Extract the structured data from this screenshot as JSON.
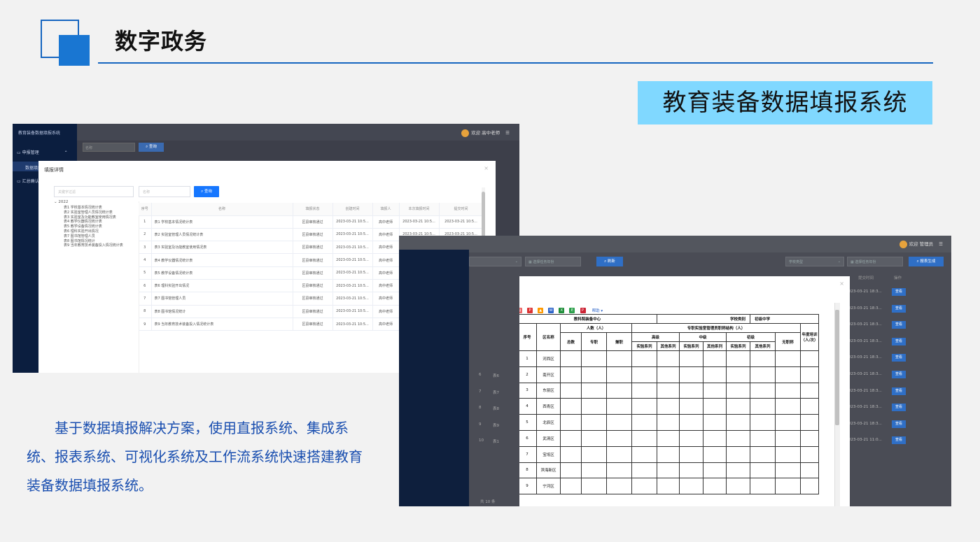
{
  "header": {
    "title": "数字政务",
    "system_banner": "教育装备数据填报系统",
    "description": "基于数据填报解决方案，使用直报系统、集成系统、报表系统、可视化系统及工作流系统快速搭建教育装备数据填报系统。"
  },
  "screenshot1": {
    "app_title": "教育装备数据填报系统",
    "menu": [
      "申报管理",
      "数据填报",
      "汇总确认"
    ],
    "user_label": "欢迎 高中老师",
    "bg_search_placeholder": "名称",
    "bg_search_button": "查询",
    "dialog": {
      "title": "填报详情",
      "keyword_placeholder": "关键字过滤",
      "name_placeholder": "名称",
      "query_button": "查询",
      "tree_year": "2022",
      "tree_items": [
        "表1 学校基本情况统计表",
        "表2 实验室管理人员情况统计表",
        "表3 实验室及功能教室使用情况表",
        "表4 教学仪器情况统计表",
        "表5 教学设备情况统计表",
        "表6 理科实验开出情况",
        "表7 图书馆管理人员",
        "表8 图书馆情况统计",
        "表9 当年教育技术装备投入情况统计表"
      ],
      "columns": [
        "序号",
        "名称",
        "填报状态",
        "创建时间",
        "填报人",
        "本次填报时间",
        "提交时间"
      ],
      "rows": [
        {
          "no": "1",
          "name": "表1 学校基本情况统计表",
          "status": "区县审核通过",
          "created": "2023-03-21 10:5...",
          "filler": "高中老师",
          "filled": "2023-03-21 10:5...",
          "submitted": "2023-03-21 10:5..."
        },
        {
          "no": "2",
          "name": "表2 实验室管理人员情况统计表",
          "status": "区县审核通过",
          "created": "2023-03-21 10:5...",
          "filler": "高中老师",
          "filled": "2023-03-21 10:5...",
          "submitted": "2023-03-21 10:5..."
        },
        {
          "no": "3",
          "name": "表3 实验室及功能教室使用情况表",
          "status": "区县审核通过",
          "created": "2023-03-21 10:5...",
          "filler": "高中老师",
          "filled": "2023-03-21 10:5...",
          "submitted": "2023-03-21 10:5..."
        },
        {
          "no": "4",
          "name": "表4 教学仪器情况统计表",
          "status": "区县审核通过",
          "created": "2023-03-21 10:5...",
          "filler": "高中老师",
          "filled": "2023-03-21 10:5...",
          "submitted": "2023-03-21 10:5..."
        },
        {
          "no": "5",
          "name": "表5 教学设备情况统计表",
          "status": "区县审核通过",
          "created": "2023-03-21 10:5...",
          "filler": "高中老师",
          "filled": "2023-03-21 10:5...",
          "submitted": "2023-03-21 10:5..."
        },
        {
          "no": "6",
          "name": "表6 理科实验开出情况",
          "status": "区县审核通过",
          "created": "2023-03-21 10:5...",
          "filler": "高中老师",
          "filled": "2023-03-21 10:5...",
          "submitted": "2023-03-21 10:5..."
        },
        {
          "no": "7",
          "name": "表7 图书馆管理人员",
          "status": "区县审核通过",
          "created": "2023-03-21 10:5...",
          "filler": "高中老师",
          "filled": "2023-03-21 10:5...",
          "submitted": "2023-03-21 10:5..."
        },
        {
          "no": "8",
          "name": "表8 图书馆情况统计",
          "status": "区县审核通过",
          "created": "2023-03-21 10:5...",
          "filler": "高中老师",
          "filled": "2023-03-21 10:5...",
          "submitted": "2023-03-21 10:5..."
        },
        {
          "no": "9",
          "name": "表9 当年教育技术装备投入情况统计表",
          "status": "区县审核通过",
          "created": "2023-03-21 10:5...",
          "filler": "高中老师",
          "filled": "2023-03-21 10:5...",
          "submitted": "2023-03-21 10:5..."
        }
      ]
    }
  },
  "screenshot2": {
    "user_label": "欢迎 管理员",
    "task_placeholder_left": "选择任务年份",
    "query_button": "刷新",
    "school_type_placeholder": "学校类型",
    "task_placeholder_right": "选择任务年份",
    "generate_button": "报表生成",
    "col_time": "提交时间",
    "col_action": "操作",
    "view_label": "查看",
    "right_times": [
      "023-03-21 18:3...",
      "023-03-21 18:3...",
      "023-03-21 18:3...",
      "023-03-21 18:3...",
      "023-03-21 18:3...",
      "023-03-21 18:3...",
      "023-03-21 18:3...",
      "023-03-21 18:3...",
      "023-03-21 18:3...",
      "023-03-21 11:0..."
    ],
    "left_rows": [
      {
        "no": "6",
        "name": "表6"
      },
      {
        "no": "7",
        "name": "表7"
      },
      {
        "no": "8",
        "name": "表8"
      },
      {
        "no": "9",
        "name": "表9"
      },
      {
        "no": "10",
        "name": "表1"
      }
    ],
    "total_label": "共 10 条",
    "dialog": {
      "help": "帮助",
      "toolbar_icons": [
        "print-icon",
        "pdf-icon",
        "excel-icon",
        "word-icon",
        "export-icon"
      ],
      "table_title": "教科院装备中心",
      "school_type_label": "学校类别",
      "school_type_value": "初级中学",
      "h_no": "序号",
      "h_district": "区名称",
      "h_people": "人数（人）",
      "h_total": "总数",
      "h_full": "专职",
      "h_part": "兼职",
      "h_title_structure": "专职实验室管理员职称结构（人）",
      "h_senior": "高级",
      "h_middle": "中级",
      "h_junior": "初级",
      "h_none": "无职称",
      "h_lab": "实验系列",
      "h_other": "其他系列",
      "h_training": "年度培训（人/次）",
      "districts": [
        {
          "no": "1",
          "name": "河西区"
        },
        {
          "no": "2",
          "name": "南开区"
        },
        {
          "no": "3",
          "name": "东丽区"
        },
        {
          "no": "4",
          "name": "西青区"
        },
        {
          "no": "5",
          "name": "北辰区"
        },
        {
          "no": "6",
          "name": "武清区"
        },
        {
          "no": "7",
          "name": "宝坻区"
        },
        {
          "no": "8",
          "name": "滨海新区"
        },
        {
          "no": "9",
          "name": "宁河区"
        }
      ]
    }
  },
  "colors": {
    "accent": "#1976d2",
    "banner": "#80d8ff",
    "description": "#1a4fb0"
  }
}
